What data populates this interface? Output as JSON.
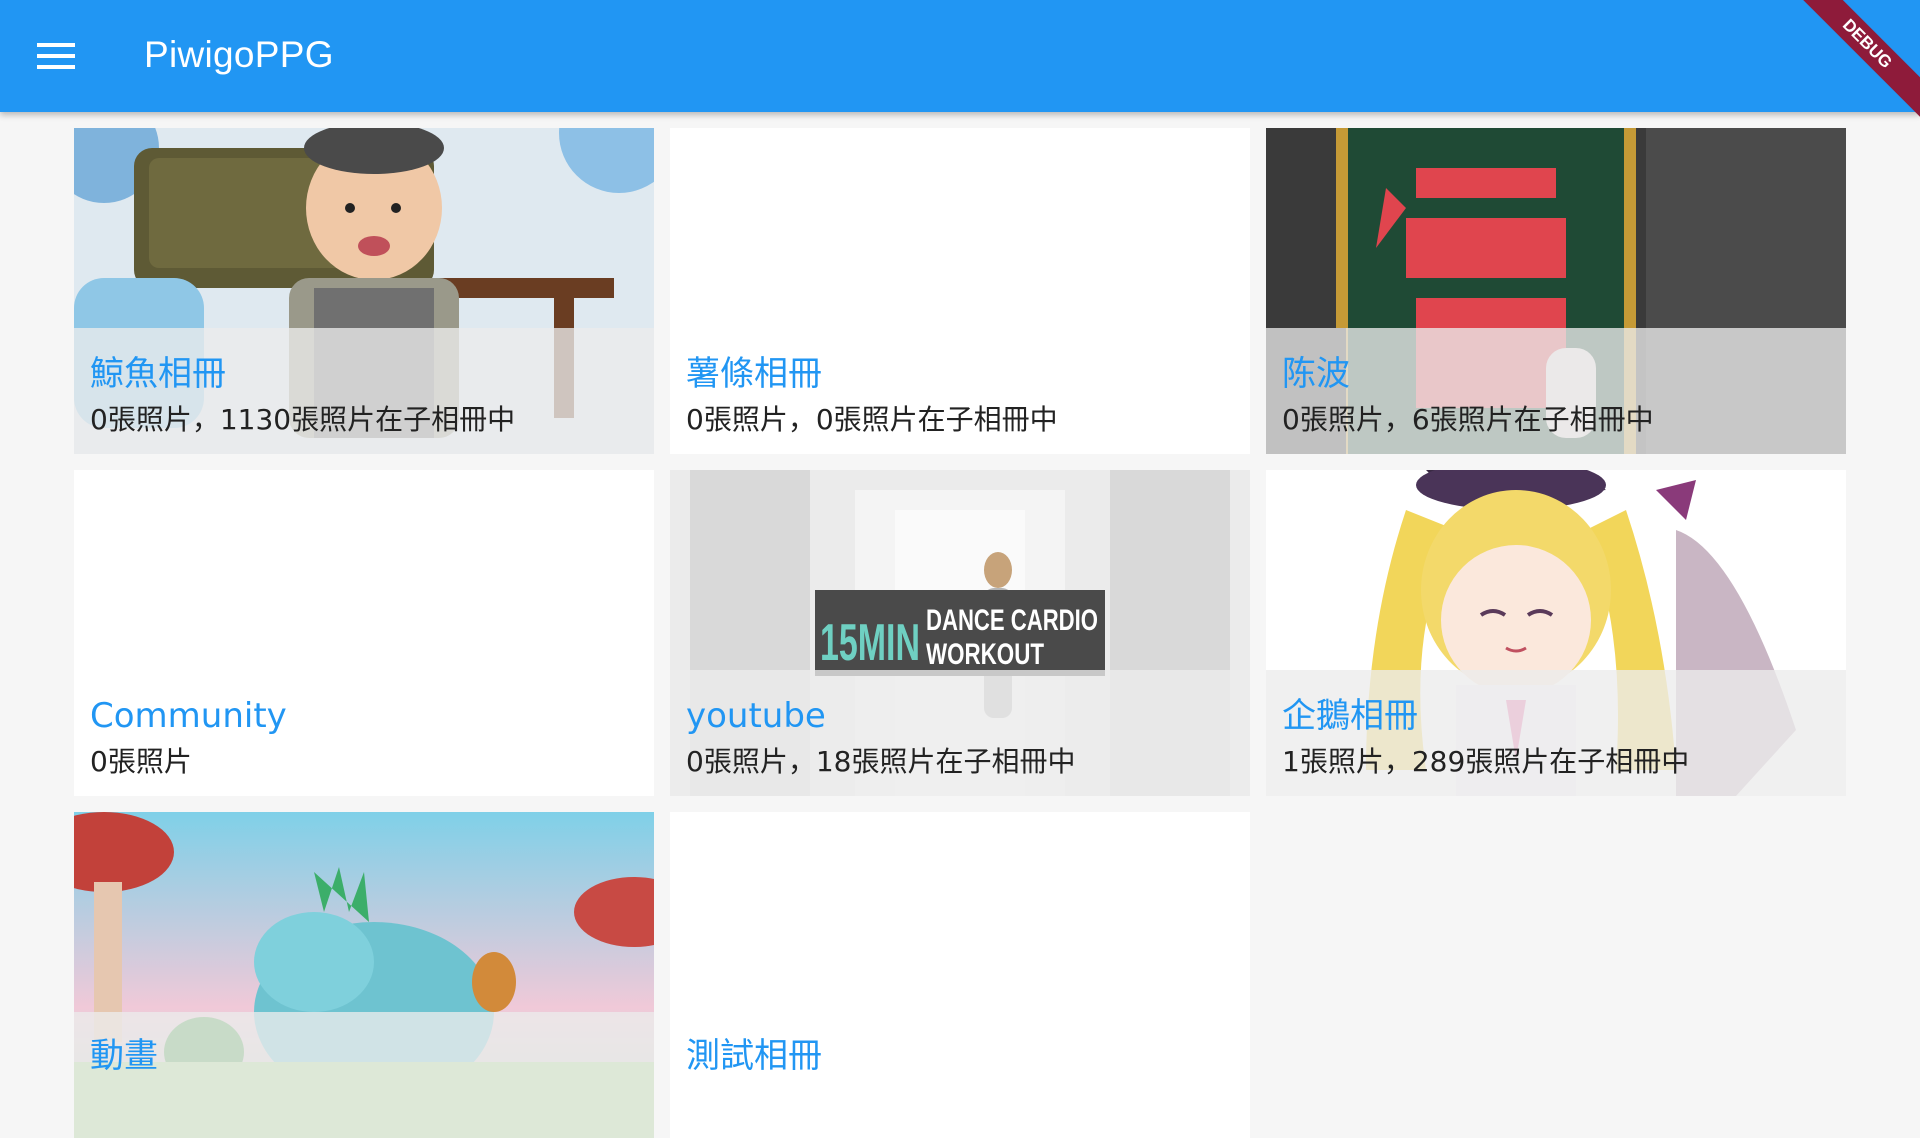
{
  "app": {
    "title": "PiwigoPPG",
    "debug_label": "DEBUG",
    "accent": "#2196F3"
  },
  "albums": [
    {
      "name": "鯨魚相冊",
      "count": "0張照片，1130張照片在子相冊中",
      "thumb": "baby-photo"
    },
    {
      "name": "薯條相冊",
      "count": "0張照片，0張照片在子相冊中",
      "thumb": "none"
    },
    {
      "name": "陈波",
      "count": "0張照片，6張照片在子相冊中",
      "thumb": "fu-character-photo"
    },
    {
      "name": "Community",
      "count": "0張照片",
      "thumb": "none"
    },
    {
      "name": "youtube",
      "count": "0張照片，18張照片在子相冊中",
      "thumb": "dance-workout-video",
      "thumb_text": [
        "15MIN",
        "DANCE CARDIO",
        "WORKOUT"
      ]
    },
    {
      "name": "企鵝相冊",
      "count": "1張照片，289張照片在子相冊中",
      "thumb": "anime-girl-illustration"
    },
    {
      "name": "動畫",
      "count": "",
      "thumb": "cartoon-dinosaur"
    },
    {
      "name": "測試相冊",
      "count": "",
      "thumb": "none"
    }
  ]
}
